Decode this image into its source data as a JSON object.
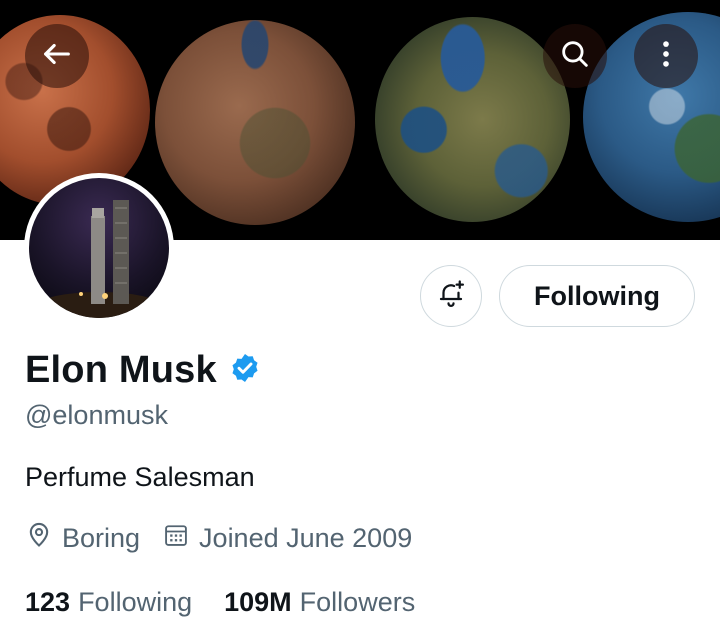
{
  "header": {
    "icons": {
      "back": "arrow-left-icon",
      "search": "search-icon",
      "more": "more-vertical-icon"
    }
  },
  "profile": {
    "display_name": "Elon Musk",
    "verified": true,
    "handle": "@elonmusk",
    "bio": "Perfume Salesman",
    "location": "Boring",
    "joined": "Joined June 2009",
    "following_count": "123",
    "following_label": "Following",
    "followers_count": "109M",
    "followers_label": "Followers"
  },
  "actions": {
    "notify_icon": "bell-plus-icon",
    "follow_label": "Following"
  },
  "colors": {
    "verified_badge": "#1d9bf0",
    "secondary_text": "#536471",
    "primary_text": "#0f1419",
    "button_border": "#cfd9de"
  }
}
